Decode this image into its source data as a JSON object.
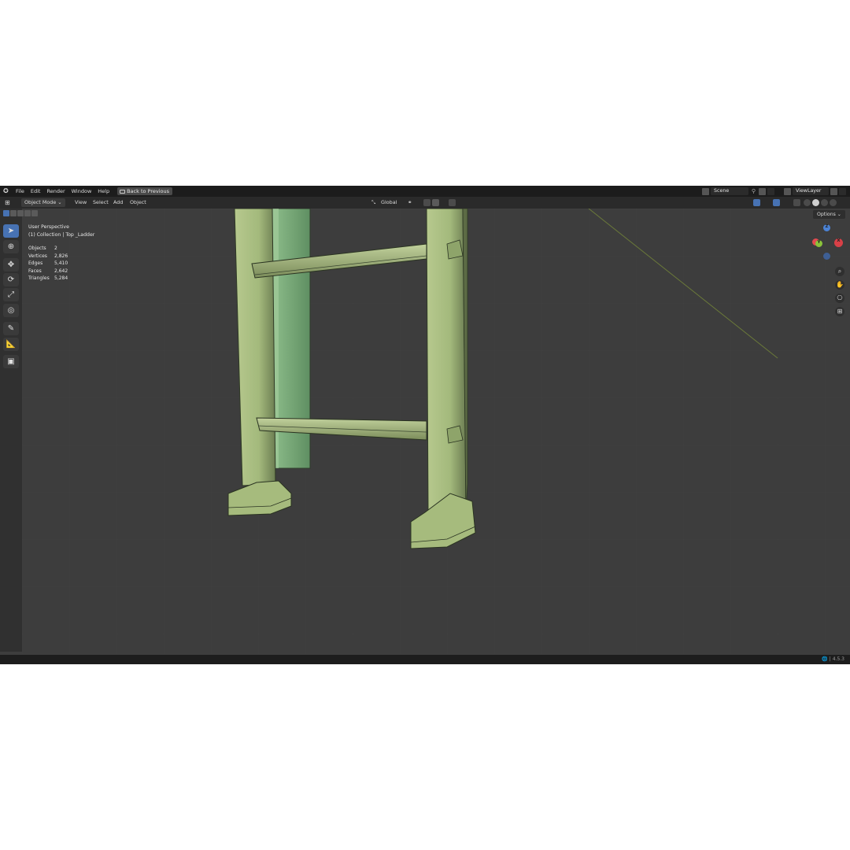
{
  "topbar": {
    "menus": [
      "File",
      "Edit",
      "Render",
      "Window",
      "Help"
    ],
    "back_button": "Back to Previous",
    "scene": "Scene",
    "view_layer": "ViewLayer"
  },
  "header": {
    "mode": "Object Mode",
    "menus": [
      "View",
      "Select",
      "Add",
      "Object"
    ],
    "transform_orientation": "Global",
    "options": "Options"
  },
  "viewport": {
    "perspective": "User Perspective",
    "collection": "(1) Collection | Top _Ladder",
    "stats": [
      {
        "label": "Objects",
        "value": "2"
      },
      {
        "label": "Vertices",
        "value": "2,826"
      },
      {
        "label": "Edges",
        "value": "5,410"
      },
      {
        "label": "Faces",
        "value": "2,642"
      },
      {
        "label": "Triangles",
        "value": "5,284"
      }
    ]
  },
  "gizmo": {
    "z": "Z",
    "y": "Y",
    "x": "X"
  },
  "status": {
    "version": "4.5.3"
  },
  "colors": {
    "accent": "#4772b3",
    "model": "#a8bf7f",
    "background": "#3d3d3d"
  }
}
